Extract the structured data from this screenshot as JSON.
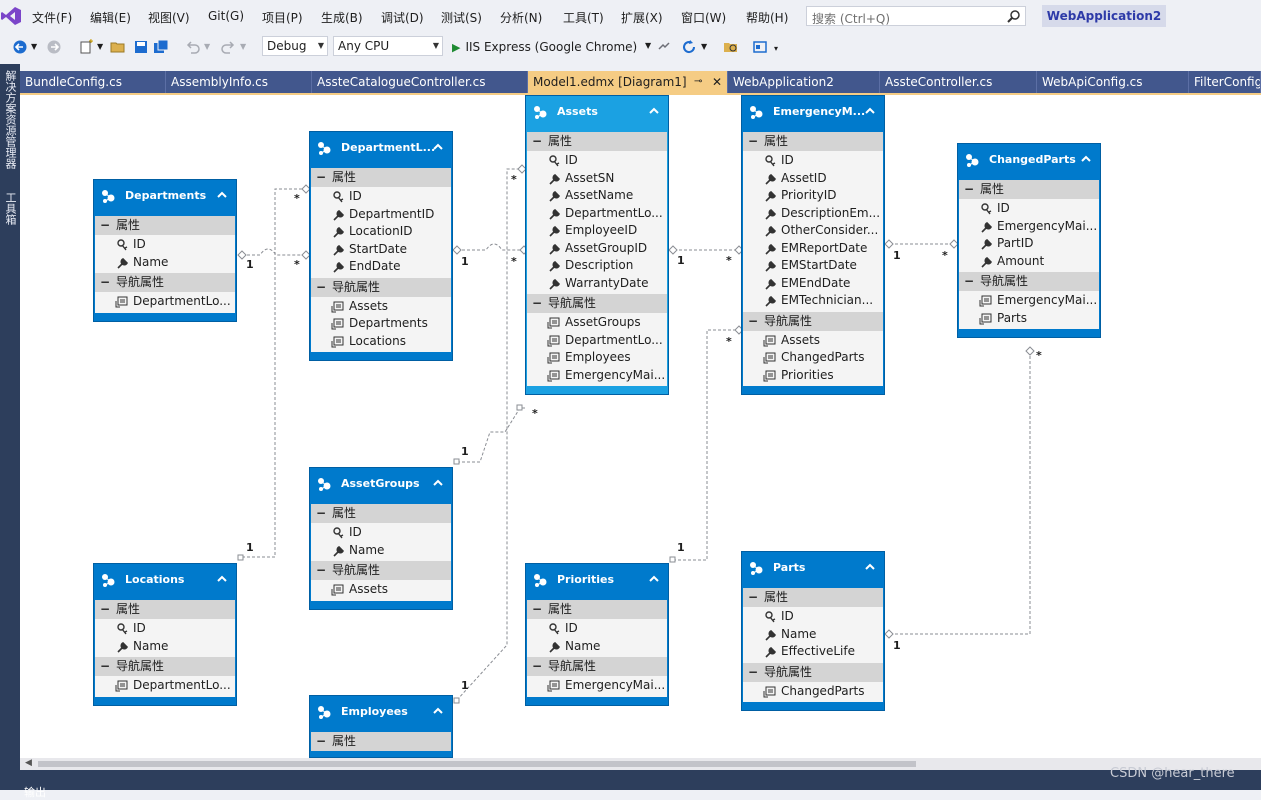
{
  "menu": {
    "items": [
      "文件(F)",
      "编辑(E)",
      "视图(V)",
      "Git(G)",
      "项目(P)",
      "生成(B)",
      "调试(D)",
      "测试(S)",
      "分析(N)",
      "工具(T)",
      "扩展(X)",
      "窗口(W)",
      "帮助(H)"
    ],
    "search_placeholder": "搜索 (Ctrl+Q)",
    "solution_title": "WebApplication2"
  },
  "toolbar": {
    "configuration": "Debug",
    "platform": "Any CPU",
    "run_label": "IIS Express (Google Chrome)"
  },
  "left_strip": {
    "tabs": [
      "解决方案资源管理器",
      "工具箱"
    ]
  },
  "tabs": [
    {
      "label": "BundleConfig.cs"
    },
    {
      "label": "AssemblyInfo.cs"
    },
    {
      "label": "AssteCatalogueController.cs"
    },
    {
      "label": "Model1.edmx [Diagram1]"
    },
    {
      "label": "WebApplication2"
    },
    {
      "label": "AssteController.cs"
    },
    {
      "label": "WebApiConfig.cs"
    },
    {
      "label": "FilterConfig"
    }
  ],
  "sections": {
    "props": "属性",
    "nav": "导航属性"
  },
  "entities": {
    "departments": {
      "title": "Departments",
      "props": [
        "ID",
        "Name"
      ],
      "nav": [
        "DepartmentLo..."
      ]
    },
    "departmentlocations": {
      "title": "DepartmentL...",
      "props": [
        "ID",
        "DepartmentID",
        "LocationID",
        "StartDate",
        "EndDate"
      ],
      "nav": [
        "Assets",
        "Departments",
        "Locations"
      ]
    },
    "assets": {
      "title": "Assets",
      "props": [
        "ID",
        "AssetSN",
        "AssetName",
        "DepartmentLo...",
        "EmployeeID",
        "AssetGroupID",
        "Description",
        "WarrantyDate"
      ],
      "nav": [
        "AssetGroups",
        "DepartmentLo...",
        "Employees",
        "EmergencyMai..."
      ]
    },
    "emergency": {
      "title": "EmergencyM...",
      "props": [
        "ID",
        "AssetID",
        "PriorityID",
        "DescriptionEm...",
        "OtherConsider...",
        "EMReportDate",
        "EMStartDate",
        "EMEndDate",
        "EMTechnician..."
      ],
      "nav": [
        "Assets",
        "ChangedParts",
        "Priorities"
      ]
    },
    "changedparts": {
      "title": "ChangedParts",
      "props": [
        "ID",
        "EmergencyMai...",
        "PartID",
        "Amount"
      ],
      "nav": [
        "EmergencyMai...",
        "Parts"
      ]
    },
    "locations": {
      "title": "Locations",
      "props": [
        "ID",
        "Name"
      ],
      "nav": [
        "DepartmentLo..."
      ]
    },
    "assetgroups": {
      "title": "AssetGroups",
      "props": [
        "ID",
        "Name"
      ],
      "nav": [
        "Assets"
      ]
    },
    "priorities": {
      "title": "Priorities",
      "props": [
        "ID",
        "Name"
      ],
      "nav": [
        "EmergencyMai..."
      ]
    },
    "parts": {
      "title": "Parts",
      "props": [
        "ID",
        "Name",
        "EffectiveLife"
      ],
      "nav": [
        "ChangedParts"
      ]
    },
    "employees": {
      "title": "Employees",
      "props": [],
      "nav": []
    }
  },
  "multiplicity": {
    "one": "1",
    "many": "*"
  },
  "watermark": "CSDN @hear_there",
  "output_label": "输出"
}
